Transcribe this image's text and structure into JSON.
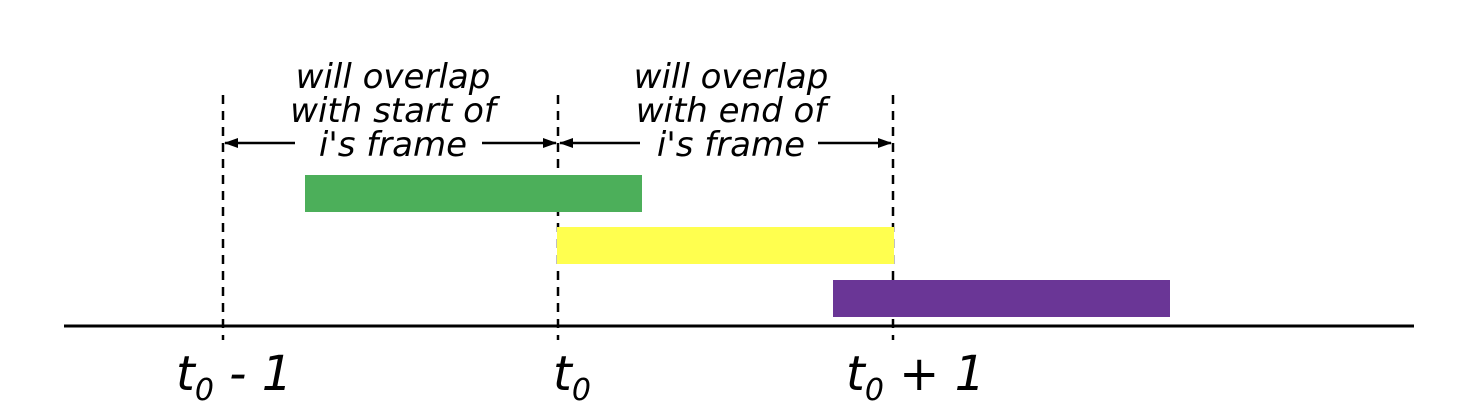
{
  "annotations": {
    "left": {
      "line1": "will overlap",
      "line2": "with start of",
      "line3": "i's frame"
    },
    "right": {
      "line1": "will overlap",
      "line2": "with end of",
      "line3": "i's frame"
    }
  },
  "ticks": {
    "left": {
      "base": "t",
      "sub": "0",
      "suffix": " - 1"
    },
    "mid": {
      "base": "t",
      "sub": "0",
      "suffix": ""
    },
    "right": {
      "base": "t",
      "sub": "0",
      "suffix": " + 1"
    }
  },
  "colors": {
    "frame_green": "#4caf5a",
    "frame_yellow": "#ffff4f",
    "frame_purple": "#6a3696",
    "line": "#000000"
  }
}
